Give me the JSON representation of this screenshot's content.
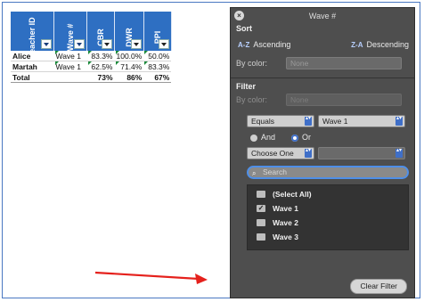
{
  "sheet": {
    "headers": [
      {
        "label": "Teacher ID",
        "filter_active": true
      },
      {
        "label": "Wave #",
        "filter_active": true
      },
      {
        "label": "CBR",
        "filter_active": false
      },
      {
        "label": "DWR",
        "filter_active": false
      },
      {
        "label": "PPI",
        "filter_active": false
      }
    ],
    "rows": [
      {
        "cells": [
          "Alice",
          "Wave 1",
          "83.3%",
          "100.0%",
          "50.0%"
        ]
      },
      {
        "cells": [
          "Martah",
          "Wave 1",
          "62.5%",
          "71.4%",
          "83.3%"
        ]
      }
    ],
    "total": {
      "cells": [
        "Total",
        "",
        "73%",
        "86%",
        "67%"
      ]
    }
  },
  "panel": {
    "title": "Wave #",
    "sort": {
      "section_label": "Sort",
      "ascending_icon": "A-Z",
      "ascending_label": "Ascending",
      "descending_icon": "Z-A",
      "descending_label": "Descending",
      "by_color_label": "By color:",
      "by_color_value": "None"
    },
    "filter": {
      "section_label": "Filter",
      "by_color_label": "By color:",
      "by_color_value": "None",
      "condition1_op": "Equals",
      "condition1_value": "Wave 1",
      "and_label": "And",
      "or_label": "Or",
      "selected_logic": "Or",
      "condition2_op": "Choose One",
      "condition2_value": "",
      "search_placeholder": "Search",
      "items": [
        {
          "label": "(Select All)",
          "checked": false
        },
        {
          "label": "Wave 1",
          "checked": true
        },
        {
          "label": "Wave 2",
          "checked": false
        },
        {
          "label": "Wave 3",
          "checked": false
        }
      ],
      "clear_label": "Clear Filter"
    }
  },
  "colors": {
    "header_blue": "#2e6fc2",
    "panel_bg": "#4e4e4e",
    "accent_blue": "#4f8fe8",
    "arrow_red": "#e5211c",
    "mark_green": "#1a8a3a"
  }
}
